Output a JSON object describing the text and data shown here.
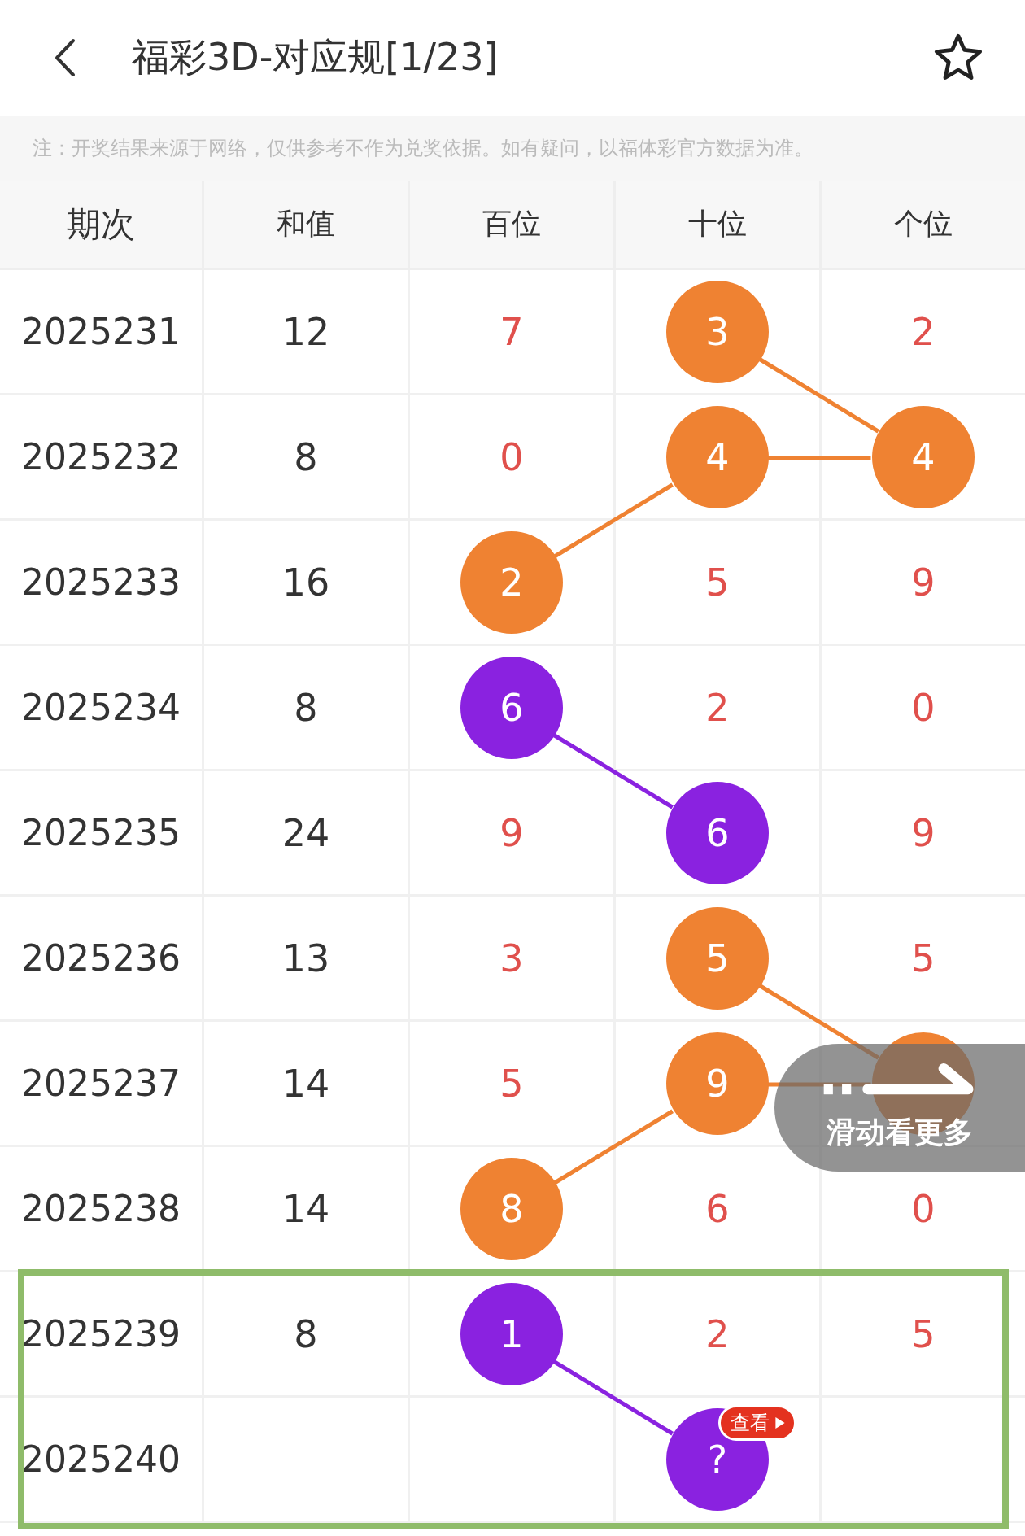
{
  "header": {
    "title": "福彩3D-对应规[1/23]"
  },
  "notice": "注：开奖结果来源于网络，仅供参考不作为兑奖依据。如有疑问，以福体彩官方数据为准。",
  "table": {
    "columns": [
      "期次",
      "和值",
      "百位",
      "十位",
      "个位"
    ],
    "rows": [
      {
        "issue": "2025231",
        "sum": "12",
        "highlighted": false,
        "digits": [
          {
            "value": "7",
            "kind": "plain"
          },
          {
            "value": "3",
            "kind": "ball",
            "color": "#ef8232"
          },
          {
            "value": "2",
            "kind": "plain"
          }
        ]
      },
      {
        "issue": "2025232",
        "sum": "8",
        "highlighted": false,
        "digits": [
          {
            "value": "0",
            "kind": "plain"
          },
          {
            "value": "4",
            "kind": "ball",
            "color": "#ef8232"
          },
          {
            "value": "4",
            "kind": "ball",
            "color": "#ef8232"
          }
        ]
      },
      {
        "issue": "2025233",
        "sum": "16",
        "highlighted": false,
        "digits": [
          {
            "value": "2",
            "kind": "ball",
            "color": "#ef8232"
          },
          {
            "value": "5",
            "kind": "plain"
          },
          {
            "value": "9",
            "kind": "plain"
          }
        ]
      },
      {
        "issue": "2025234",
        "sum": "8",
        "highlighted": false,
        "digits": [
          {
            "value": "6",
            "kind": "ball",
            "color": "#8a22e0"
          },
          {
            "value": "2",
            "kind": "plain"
          },
          {
            "value": "0",
            "kind": "plain"
          }
        ]
      },
      {
        "issue": "2025235",
        "sum": "24",
        "highlighted": false,
        "digits": [
          {
            "value": "9",
            "kind": "plain"
          },
          {
            "value": "6",
            "kind": "ball",
            "color": "#8a22e0"
          },
          {
            "value": "9",
            "kind": "plain"
          }
        ]
      },
      {
        "issue": "2025236",
        "sum": "13",
        "highlighted": false,
        "digits": [
          {
            "value": "3",
            "kind": "plain"
          },
          {
            "value": "5",
            "kind": "ball",
            "color": "#ef8232"
          },
          {
            "value": "5",
            "kind": "plain"
          }
        ]
      },
      {
        "issue": "2025237",
        "sum": "14",
        "highlighted": false,
        "digits": [
          {
            "value": "5",
            "kind": "plain"
          },
          {
            "value": "9",
            "kind": "ball",
            "color": "#ef8232"
          },
          {
            "kind": "ball",
            "color": "#ef8232"
          }
        ]
      },
      {
        "issue": "2025238",
        "sum": "14",
        "highlighted": false,
        "digits": [
          {
            "value": "8",
            "kind": "ball",
            "color": "#ef8232"
          },
          {
            "value": "6",
            "kind": "plain"
          },
          {
            "value": "0",
            "kind": "plain"
          }
        ]
      },
      {
        "issue": "2025239",
        "sum": "8",
        "highlighted": true,
        "digits": [
          {
            "value": "1",
            "kind": "ball",
            "color": "#8a22e0"
          },
          {
            "value": "2",
            "kind": "plain"
          },
          {
            "value": "5",
            "kind": "plain"
          }
        ]
      },
      {
        "issue": "2025240",
        "highlighted": true,
        "digits": [
          {
            "kind": "empty"
          },
          {
            "value": "?",
            "kind": "ball",
            "color": "#8a22e0",
            "badge": "查看"
          },
          {
            "kind": "empty"
          }
        ]
      }
    ]
  },
  "swipe_hint": "滑动看更多"
}
